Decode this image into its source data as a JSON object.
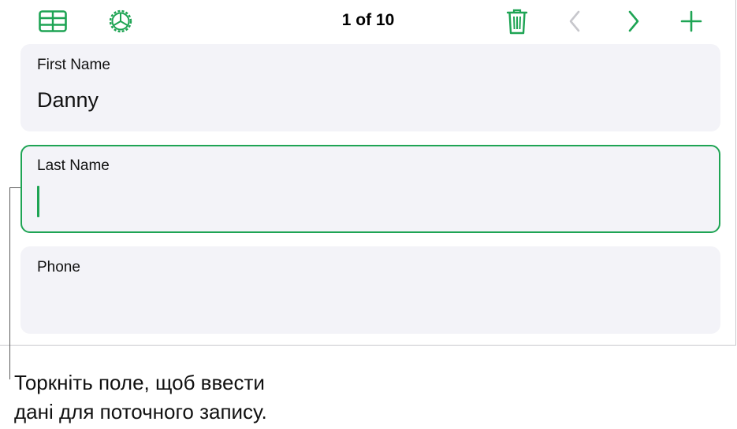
{
  "toolbar": {
    "record_counter": "1 of 10",
    "icons": {
      "table": "table-view-icon",
      "settings": "gear-icon",
      "delete": "trash-icon",
      "previous": "chevron-left-icon",
      "next": "chevron-right-icon",
      "add": "plus-icon"
    }
  },
  "fields": [
    {
      "label": "First Name",
      "value": "Danny"
    },
    {
      "label": "Last Name",
      "value": ""
    },
    {
      "label": "Phone",
      "value": ""
    }
  ],
  "callout": {
    "line1": "Торкніть поле, щоб ввести",
    "line2": "дані для поточного запису."
  },
  "colors": {
    "accent": "#1ea454",
    "disabled": "#c7c7cc",
    "card_background": "#f3f3f8"
  }
}
